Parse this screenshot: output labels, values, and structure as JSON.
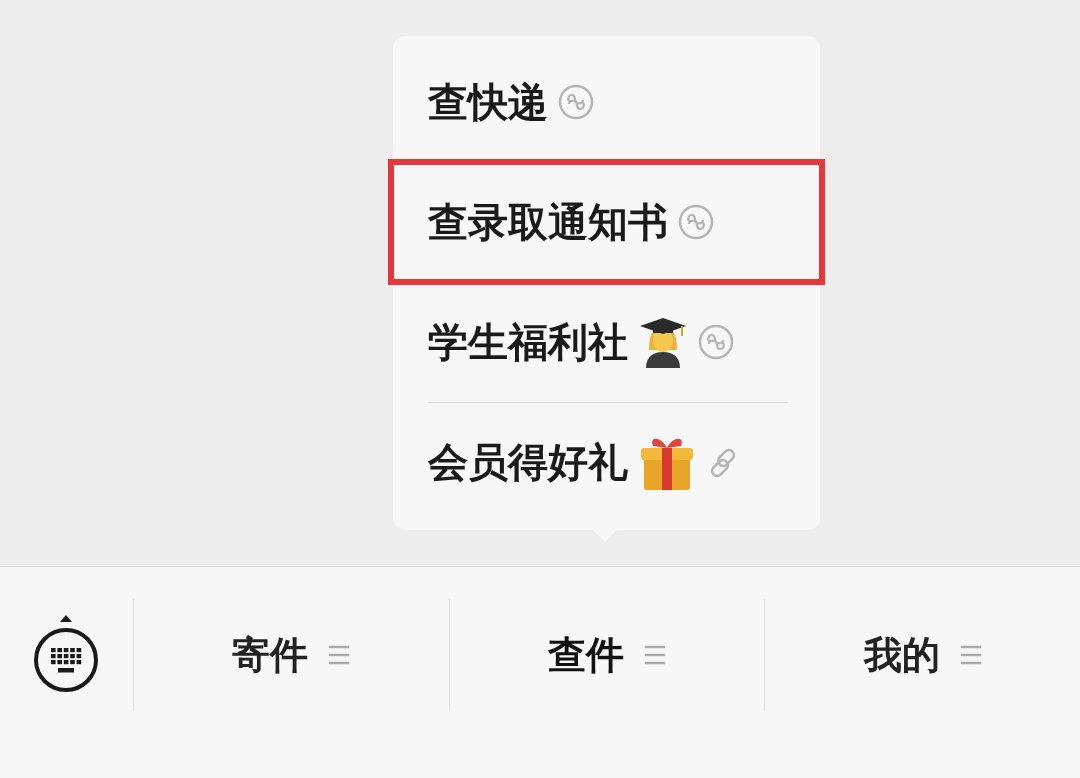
{
  "popup_menu": {
    "items": [
      {
        "label": "查快递",
        "kind": "plain",
        "highlighted": false,
        "separated": false
      },
      {
        "label": "查录取通知书",
        "kind": "plain",
        "highlighted": true,
        "separated": false
      },
      {
        "label": "学生福利社",
        "kind": "graduate",
        "highlighted": false,
        "separated": false
      },
      {
        "label": "会员得好礼",
        "kind": "gift",
        "highlighted": false,
        "separated": true
      }
    ]
  },
  "bottom_menu": {
    "tabs": [
      {
        "label": "寄件",
        "selected": false
      },
      {
        "label": "查件",
        "selected": true
      },
      {
        "label": "我的",
        "selected": false
      }
    ]
  }
}
